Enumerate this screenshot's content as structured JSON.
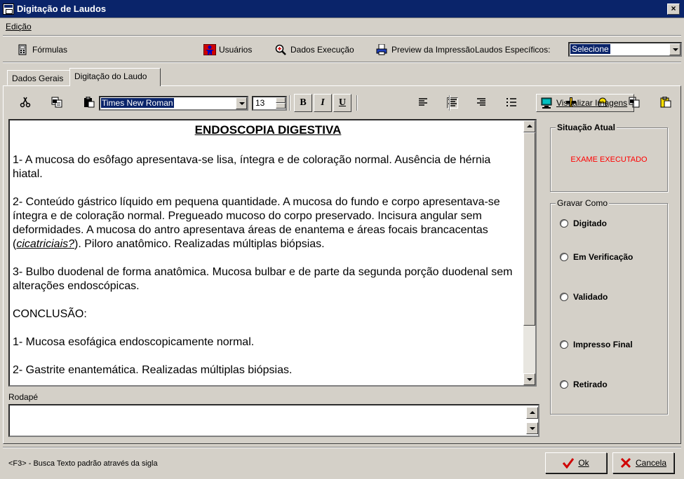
{
  "window": {
    "title": "Digitação de Laudos",
    "close_label": "×"
  },
  "menu": {
    "items": [
      {
        "label": "Edição"
      }
    ]
  },
  "toolbar": {
    "formulas": "Fórmulas",
    "usuarios": "Usuários",
    "dados_execucao": "Dados Execução",
    "preview": "Preview da Impressão",
    "laudos_label": "Laudos Específicos:",
    "laudos_select": "Selecione"
  },
  "tabs": [
    {
      "label": "Dados Gerais",
      "active": false
    },
    {
      "label": "Digitação do Laudo",
      "active": true
    }
  ],
  "format": {
    "font": "Times New Roman",
    "size": "13",
    "bold": "B",
    "italic": "I",
    "underline": "U",
    "visualizar": "Visualizar Imagens"
  },
  "document": {
    "title": "ENDOSCOPIA DIGESTIVA",
    "p1": "1-  A mucosa do esôfago apresentava-se lisa, íntegra e de coloração normal.  Ausência de hérnia hiatal.",
    "p2a": "2-  Conteúdo gástrico líquido em pequena quantidade. A mucosa do fundo e corpo apresentava-se íntegra e de coloração normal. Pregueado mucoso do corpo preservado. Incisura angular sem deformidades. A mucosa do antro apresentava áreas de enantema e áreas focais brancacentas (",
    "p2_em": "cicatriciais?",
    "p2b": "). Piloro anatômico. Realizadas múltiplas biópsias.",
    "p3": "3-  Bulbo duodenal de forma anatômica. Mucosa bulbar e de parte da segunda porção duodenal sem alterações  endoscópicas.",
    "conclusao": "CONCLUSÃO:",
    "c1": "1-  Mucosa esofágica endoscopicamente normal.",
    "c2": "2-  Gastrite enantemática. Realizadas múltiplas biópsias."
  },
  "situacao": {
    "title": "Situação Atual",
    "value": "EXAME EXECUTADO",
    "value_color": "#ff0000"
  },
  "gravar": {
    "title": "Gravar Como",
    "options": [
      {
        "label": "Digitado"
      },
      {
        "label": "Em Verificação"
      },
      {
        "label": "Validado"
      },
      {
        "label": "Impresso Final"
      },
      {
        "label": "Retirado"
      }
    ]
  },
  "footer": {
    "rodape_label": "Rodapé",
    "status": "<F3> - Busca Texto padrão através da sigla",
    "ok": "Ok",
    "cancel": "Cancela"
  }
}
